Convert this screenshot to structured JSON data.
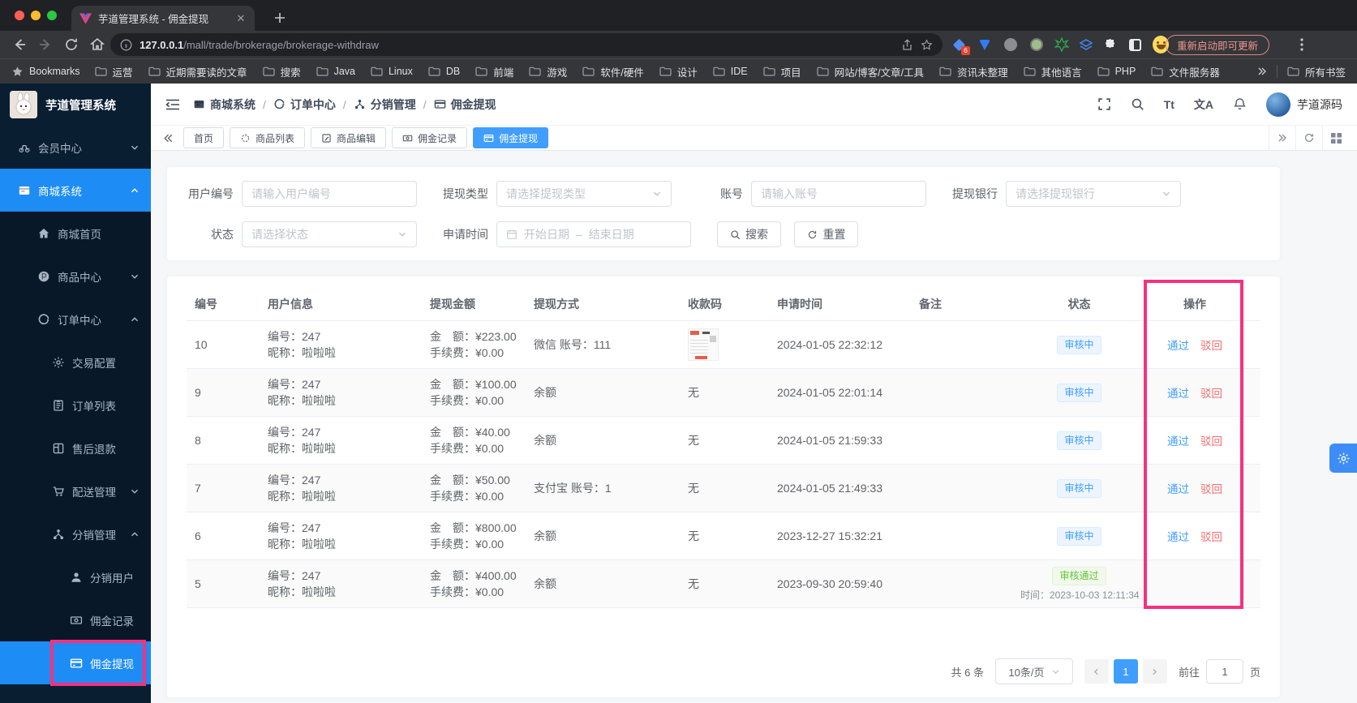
{
  "colors": {
    "accent": "#409eff",
    "annotation": "#f5317f",
    "sidebar_active": "#1d8cf5",
    "pending_text": "#409eff",
    "approved_text": "#67c23a"
  },
  "browser": {
    "tab": {
      "title": "芋道管理系统 - 佣金提现",
      "logo_icon": "vue-logo-icon",
      "close_icon": "close-icon"
    },
    "url_domain": "127.0.0.1",
    "url_path": "/mall/trade/brokerage/brokerage-withdraw",
    "update_chip": "重新启动即可更新",
    "extension_badge": "6",
    "bookmarks_root": "Bookmarks",
    "bookmarks": [
      "运营",
      "近期需要读的文章",
      "搜索",
      "Java",
      "Linux",
      "DB",
      "前端",
      "游戏",
      "软件/硬件",
      "设计",
      "IDE",
      "项目",
      "网站/博客/文章/工具",
      "资讯未整理",
      "其他语言",
      "PHP",
      "文件服务器"
    ],
    "all_bookmarks_label": "所有书签"
  },
  "sidebar": {
    "app_title": "芋道管理系统",
    "items": [
      {
        "label": "会员中心",
        "icon": "member-icon",
        "level": 1,
        "chevron": "down"
      },
      {
        "label": "商城系统",
        "icon": "mall-icon",
        "level": 1,
        "chevron": "up",
        "active": true
      },
      {
        "label": "商城首页",
        "icon": "home-icon",
        "level": 2
      },
      {
        "label": "商品中心",
        "icon": "product-icon",
        "level": 2,
        "chevron": "down"
      },
      {
        "label": "订单中心",
        "icon": "order-icon",
        "level": 2,
        "chevron": "up"
      },
      {
        "label": "交易配置",
        "icon": "gear-icon",
        "level": 3
      },
      {
        "label": "订单列表",
        "icon": "list-icon",
        "level": 3
      },
      {
        "label": "售后退款",
        "icon": "refund-icon",
        "level": 3
      },
      {
        "label": "配送管理",
        "icon": "delivery-icon",
        "level": 3,
        "chevron": "down"
      },
      {
        "label": "分销管理",
        "icon": "share-icon",
        "level": 3,
        "chevron": "up"
      },
      {
        "label": "分销用户",
        "icon": "user-icon",
        "level": 4
      },
      {
        "label": "佣金记录",
        "icon": "money-icon",
        "level": 4
      },
      {
        "label": "佣金提现",
        "icon": "card-icon",
        "level": 4,
        "active": true,
        "annotated": true
      }
    ]
  },
  "header": {
    "breadcrumb": [
      {
        "label": "商城系统",
        "icon": "mall-icon"
      },
      {
        "label": "订单中心",
        "icon": "order-icon"
      },
      {
        "label": "分销管理",
        "icon": "share-icon"
      },
      {
        "label": "佣金提现",
        "icon": "card-icon"
      }
    ],
    "separator": "/",
    "tools": {
      "font_size_text": "Tt",
      "locale_text": "文A"
    },
    "username": "芋道源码"
  },
  "tabbar": {
    "tabs": [
      {
        "label": "首页"
      },
      {
        "label": "商品列表",
        "icon": "circle-icon"
      },
      {
        "label": "商品编辑",
        "icon": "edit-icon"
      },
      {
        "label": "佣金记录",
        "icon": "money-icon"
      },
      {
        "label": "佣金提现",
        "icon": "card-icon",
        "active": true
      }
    ]
  },
  "filters": {
    "user_no": {
      "label": "用户编号",
      "placeholder": "请输入用户编号"
    },
    "type": {
      "label": "提现类型",
      "placeholder": "请选择提现类型"
    },
    "account": {
      "label": "账号",
      "placeholder": "请输入账号"
    },
    "bank": {
      "label": "提现银行",
      "placeholder": "请选择提现银行"
    },
    "status": {
      "label": "状态",
      "placeholder": "请选择状态"
    },
    "time": {
      "label": "申请时间",
      "start_placeholder": "开始日期",
      "separator": "–",
      "end_placeholder": "结束日期"
    },
    "search_label": "搜索",
    "reset_label": "重置"
  },
  "table": {
    "columns": [
      "编号",
      "用户信息",
      "提现金额",
      "提现方式",
      "收款码",
      "申请时间",
      "备注",
      "状态",
      "操作"
    ],
    "labels": {
      "user_no": "编号：",
      "nickname": "昵称：",
      "amount": "金　额：",
      "fee": "手续费：",
      "audit_time": "时间：",
      "none": "无",
      "approve": "通过",
      "reject": "驳回"
    },
    "rows": [
      {
        "id": "10",
        "user_no": "247",
        "nickname": "啦啦啦",
        "amount": "¥223.00",
        "fee": "¥0.00",
        "method": "微信 账号：111",
        "qr": "image",
        "apply_time": "2024-01-05 22:32:12",
        "remark": "",
        "status": "审核中",
        "status_type": "pending",
        "has_actions": true
      },
      {
        "id": "9",
        "user_no": "247",
        "nickname": "啦啦啦",
        "amount": "¥100.00",
        "fee": "¥0.00",
        "method": "余额",
        "qr": "无",
        "apply_time": "2024-01-05 22:01:14",
        "remark": "",
        "status": "审核中",
        "status_type": "pending",
        "has_actions": true
      },
      {
        "id": "8",
        "user_no": "247",
        "nickname": "啦啦啦",
        "amount": "¥40.00",
        "fee": "¥0.00",
        "method": "余额",
        "qr": "无",
        "apply_time": "2024-01-05 21:59:33",
        "remark": "",
        "status": "审核中",
        "status_type": "pending",
        "has_actions": true
      },
      {
        "id": "7",
        "user_no": "247",
        "nickname": "啦啦啦",
        "amount": "¥50.00",
        "fee": "¥0.00",
        "method": "支付宝 账号：1",
        "qr": "无",
        "apply_time": "2024-01-05 21:49:33",
        "remark": "",
        "status": "审核中",
        "status_type": "pending",
        "has_actions": true
      },
      {
        "id": "6",
        "user_no": "247",
        "nickname": "啦啦啦",
        "amount": "¥800.00",
        "fee": "¥0.00",
        "method": "余额",
        "qr": "无",
        "apply_time": "2023-12-27 15:32:21",
        "remark": "",
        "status": "审核中",
        "status_type": "pending",
        "has_actions": true
      },
      {
        "id": "5",
        "user_no": "247",
        "nickname": "啦啦啦",
        "amount": "¥400.00",
        "fee": "¥0.00",
        "method": "余额",
        "qr": "无",
        "apply_time": "2023-09-30 20:59:40",
        "remark": "",
        "status": "审核通过",
        "status_type": "approved",
        "audit_time": "2023-10-03 12:11:34",
        "has_actions": false
      }
    ]
  },
  "pagination": {
    "total": "共 6 条",
    "page_size": "10条/页",
    "current_page": "1",
    "goto_label": "前往",
    "goto_value": "1",
    "page_label": "页"
  }
}
